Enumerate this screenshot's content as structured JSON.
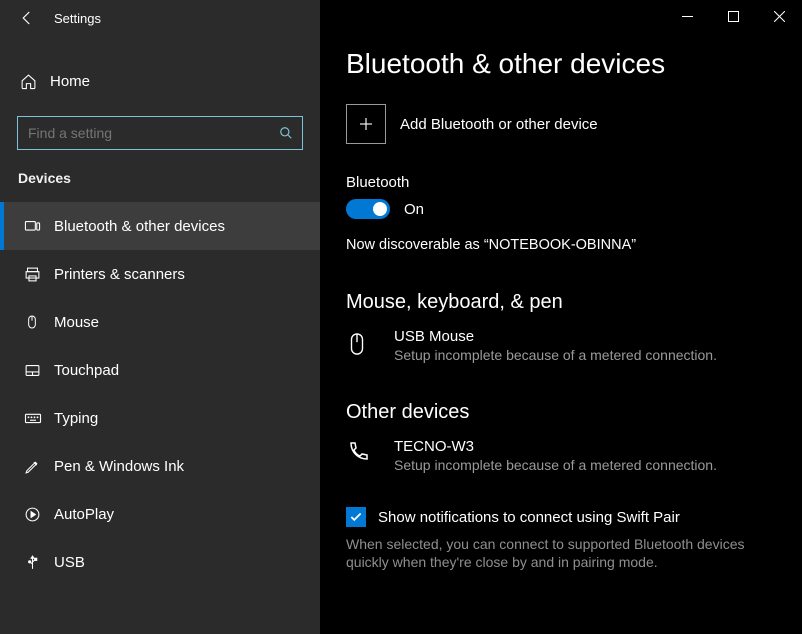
{
  "window": {
    "title": "Settings"
  },
  "sidebar": {
    "home_label": "Home",
    "search_placeholder": "Find a setting",
    "section_label": "Devices",
    "items": [
      {
        "label": "Bluetooth & other devices"
      },
      {
        "label": "Printers & scanners"
      },
      {
        "label": "Mouse"
      },
      {
        "label": "Touchpad"
      },
      {
        "label": "Typing"
      },
      {
        "label": "Pen & Windows Ink"
      },
      {
        "label": "AutoPlay"
      },
      {
        "label": "USB"
      }
    ]
  },
  "main": {
    "title": "Bluetooth & other devices",
    "add_label": "Add Bluetooth or other device",
    "bluetooth_label": "Bluetooth",
    "toggle_state": "On",
    "discoverable_text": "Now discoverable as “NOTEBOOK-OBINNA”",
    "section_mouse": "Mouse, keyboard, & pen",
    "device1_name": "USB Mouse",
    "device1_status": "Setup incomplete because of a metered connection.",
    "section_other": "Other devices",
    "device2_name": "TECNO-W3",
    "device2_status": "Setup incomplete because of a metered connection.",
    "swift_label": "Show notifications to connect using Swift Pair",
    "swift_desc": "When selected, you can connect to supported Bluetooth devices quickly when they're close by and in pairing mode."
  }
}
